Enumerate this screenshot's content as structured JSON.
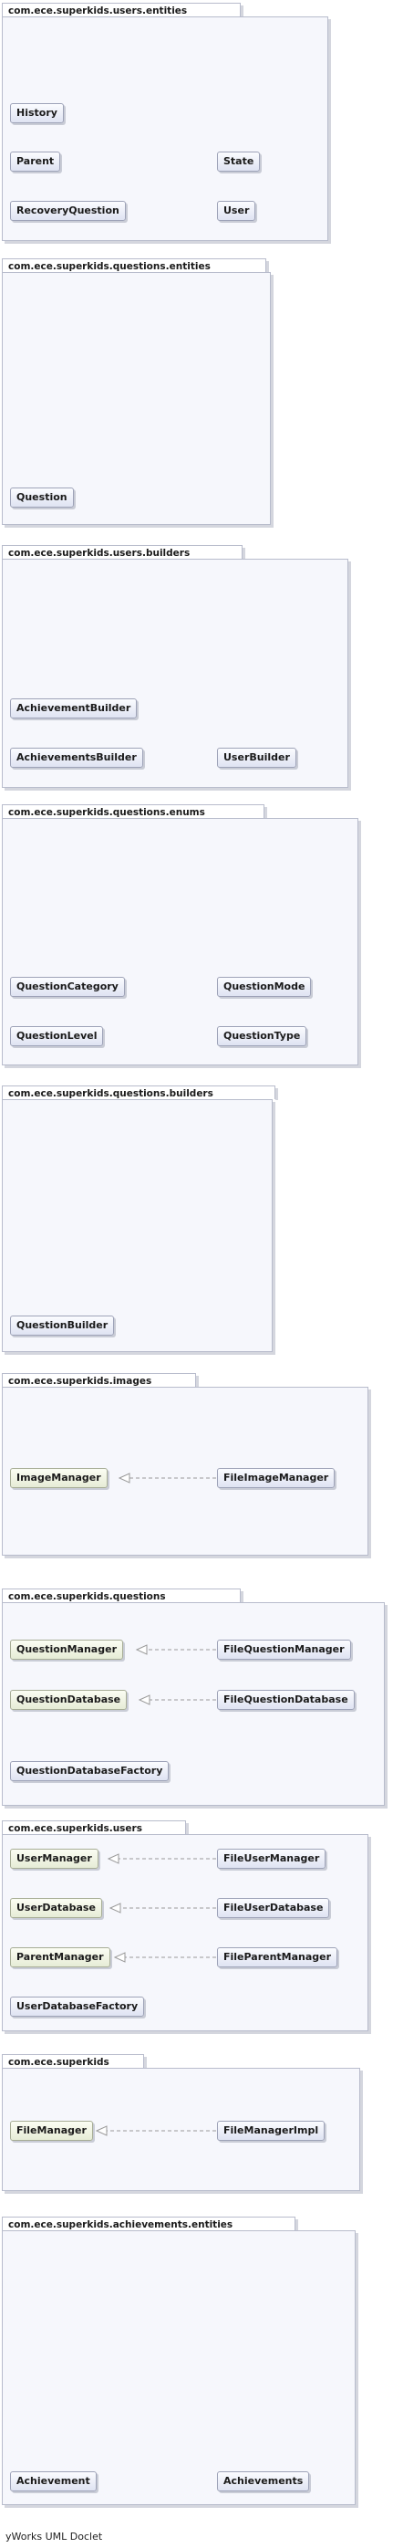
{
  "packages": [
    {
      "id": "users-entities",
      "name": "com.ece.superkids.users.entities",
      "classes": [
        "History",
        "Parent",
        "State",
        "RecoveryQuestion",
        "User"
      ]
    },
    {
      "id": "questions-entities",
      "name": "com.ece.superkids.questions.entities",
      "classes": [
        "Question"
      ]
    },
    {
      "id": "users-builders",
      "name": "com.ece.superkids.users.builders",
      "classes": [
        "AchievementBuilder",
        "AchievementsBuilder",
        "UserBuilder"
      ]
    },
    {
      "id": "questions-enums",
      "name": "com.ece.superkids.questions.enums",
      "classes": [
        "QuestionCategory",
        "QuestionMode",
        "QuestionLevel",
        "QuestionType"
      ]
    },
    {
      "id": "questions-builders",
      "name": "com.ece.superkids.questions.builders",
      "classes": [
        "QuestionBuilder"
      ]
    },
    {
      "id": "images",
      "name": "com.ece.superkids.images",
      "classes": [
        "ImageManager",
        "FileImageManager"
      ]
    },
    {
      "id": "questions",
      "name": "com.ece.superkids.questions",
      "classes": [
        "QuestionManager",
        "FileQuestionManager",
        "QuestionDatabase",
        "FileQuestionDatabase",
        "QuestionDatabaseFactory"
      ]
    },
    {
      "id": "users",
      "name": "com.ece.superkids.users",
      "classes": [
        "UserManager",
        "FileUserManager",
        "UserDatabase",
        "FileUserDatabase",
        "ParentManager",
        "FileParentManager",
        "UserDatabaseFactory"
      ]
    },
    {
      "id": "superkids",
      "name": "com.ece.superkids",
      "classes": [
        "FileManager",
        "FileManagerImpl"
      ]
    },
    {
      "id": "achievements-entities",
      "name": "com.ece.superkids.achievements.entities",
      "classes": [
        "Achievement",
        "Achievements"
      ]
    }
  ],
  "footer": "yWorks UML Doclet"
}
